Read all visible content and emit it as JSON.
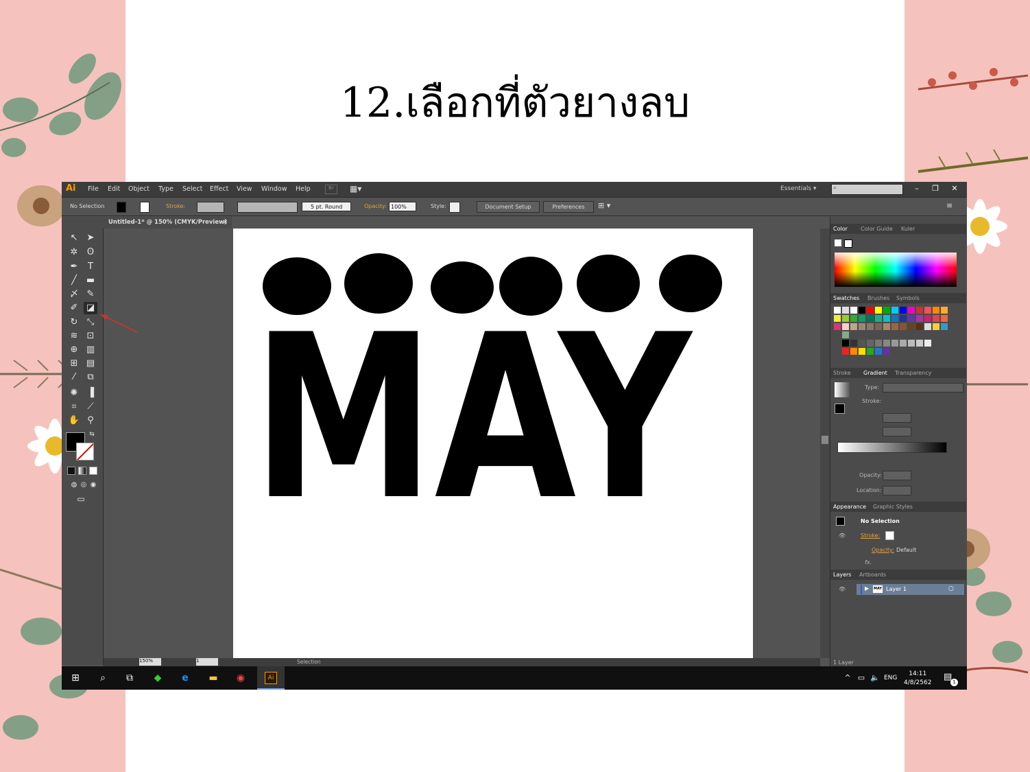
{
  "slide": {
    "title": "12.เลือกที่ตัวยางลบ"
  },
  "artwork": {
    "text": "MAY"
  },
  "app": {
    "logo": "Ai",
    "menu": [
      "File",
      "Edit",
      "Object",
      "Type",
      "Select",
      "Effect",
      "View",
      "Window",
      "Help"
    ],
    "bridge": "Br",
    "workspace": "Essentials",
    "window_buttons": [
      "–",
      "❐",
      "✕"
    ]
  },
  "control_bar": {
    "selection": "No Selection",
    "stroke_label": "Stroke:",
    "brush": "5 pt. Round",
    "opacity_label": "Opacity:",
    "opacity_value": "100%",
    "style_label": "Style:",
    "document_setup": "Document Setup",
    "preferences": "Preferences"
  },
  "document": {
    "tab_title": "Untitled-1* @ 150% (CMYK/Preview)",
    "zoom": "150%",
    "page": "1",
    "status": "Selection"
  },
  "panels": {
    "color_tabs": [
      "Color",
      "Color Guide",
      "Kuler"
    ],
    "swatch_tabs": [
      "Swatches",
      "Brushes",
      "Symbols"
    ],
    "gradient_tabs": [
      "Stroke",
      "Gradient",
      "Transparency"
    ],
    "gradient": {
      "type_label": "Type:",
      "stroke_label": "Stroke:",
      "opacity_label": "Opacity:",
      "location_label": "Location:"
    },
    "appearance_tabs": [
      "Appearance",
      "Graphic Styles"
    ],
    "appearance": {
      "no_selection": "No Selection",
      "stroke": "Stroke:",
      "opacity": "Opacity:",
      "opacity_value": "Default"
    },
    "layers_tabs": [
      "Layers",
      "Artboards"
    ],
    "layer_name": "Layer 1",
    "layer_thumb": "MAY",
    "layer_count": "1 Layer"
  },
  "taskbar": {
    "lang": "ENG",
    "time": "14:11",
    "date": "4/8/2562",
    "notifications": "1",
    "ai_app": "Ai"
  },
  "colors": {
    "side_panel": "#f6c2bd",
    "ui_dark": "#535353",
    "accent_orange": "#ff9a00",
    "arrow_red": "#c0392b"
  }
}
